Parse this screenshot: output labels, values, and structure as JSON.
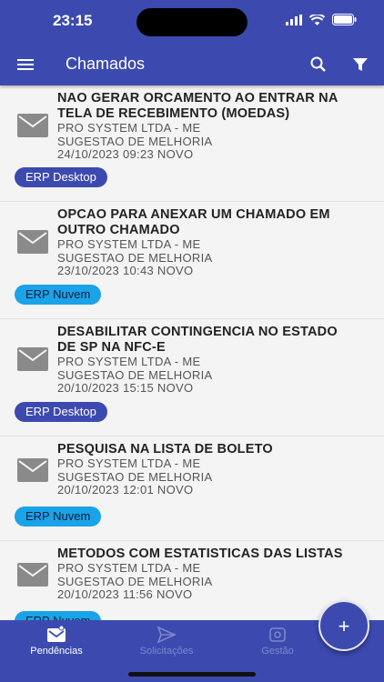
{
  "status_bar": {
    "time": "23:15"
  },
  "app_bar": {
    "title": "Chamados"
  },
  "tickets": [
    {
      "title_line1": "NAO GERAR ORCAMENTO AO ENTRAR NA",
      "title_line2": "TELA DE RECEBIMENTO (MOEDAS)",
      "company": "PRO SYSTEM LTDA - ME",
      "type": "SUGESTAO DE MELHORIA",
      "datetime_status": "24/10/2023 09:23 NOVO",
      "tag": "ERP Desktop"
    },
    {
      "title_line1": "OPCAO PARA ANEXAR UM CHAMADO EM",
      "title_line2": "OUTRO CHAMADO",
      "company": "PRO SYSTEM LTDA - ME",
      "type": "SUGESTAO DE MELHORIA",
      "datetime_status": "23/10/2023 10:43 NOVO",
      "tag": "ERP Nuvem"
    },
    {
      "title_line1": "DESABILITAR CONTINGENCIA NO ESTADO",
      "title_line2": "DE SP NA NFC-E",
      "company": "PRO SYSTEM LTDA - ME",
      "type": "SUGESTAO DE MELHORIA",
      "datetime_status": "20/10/2023 15:15 NOVO",
      "tag": "ERP Desktop"
    },
    {
      "title_line1": "PESQUISA NA LISTA DE BOLETO",
      "title_line2": "",
      "company": "PRO SYSTEM LTDA - ME",
      "type": "SUGESTAO DE MELHORIA",
      "datetime_status": "20/10/2023 12:01 NOVO",
      "tag": "ERP Nuvem"
    },
    {
      "title_line1": "METODOS COM ESTATISTICAS DAS LISTAS",
      "title_line2": "",
      "company": "PRO SYSTEM LTDA - ME",
      "type": "SUGESTAO DE MELHORIA",
      "datetime_status": "20/10/2023 11:56 NOVO",
      "tag": "ERP Nuvem"
    }
  ],
  "fab": {
    "label": "+"
  },
  "bottom_nav": [
    {
      "label": "Pendências",
      "icon": "inbox-icon",
      "active": true
    },
    {
      "label": "Solicitações",
      "icon": "send-icon",
      "active": false
    },
    {
      "label": "Gestão",
      "icon": "gestao-icon",
      "active": false
    }
  ],
  "colors": {
    "primary": "#3c4ab0",
    "chip_desktop": "#3c4ab0",
    "chip_nuvem": "#1aa3e8"
  }
}
